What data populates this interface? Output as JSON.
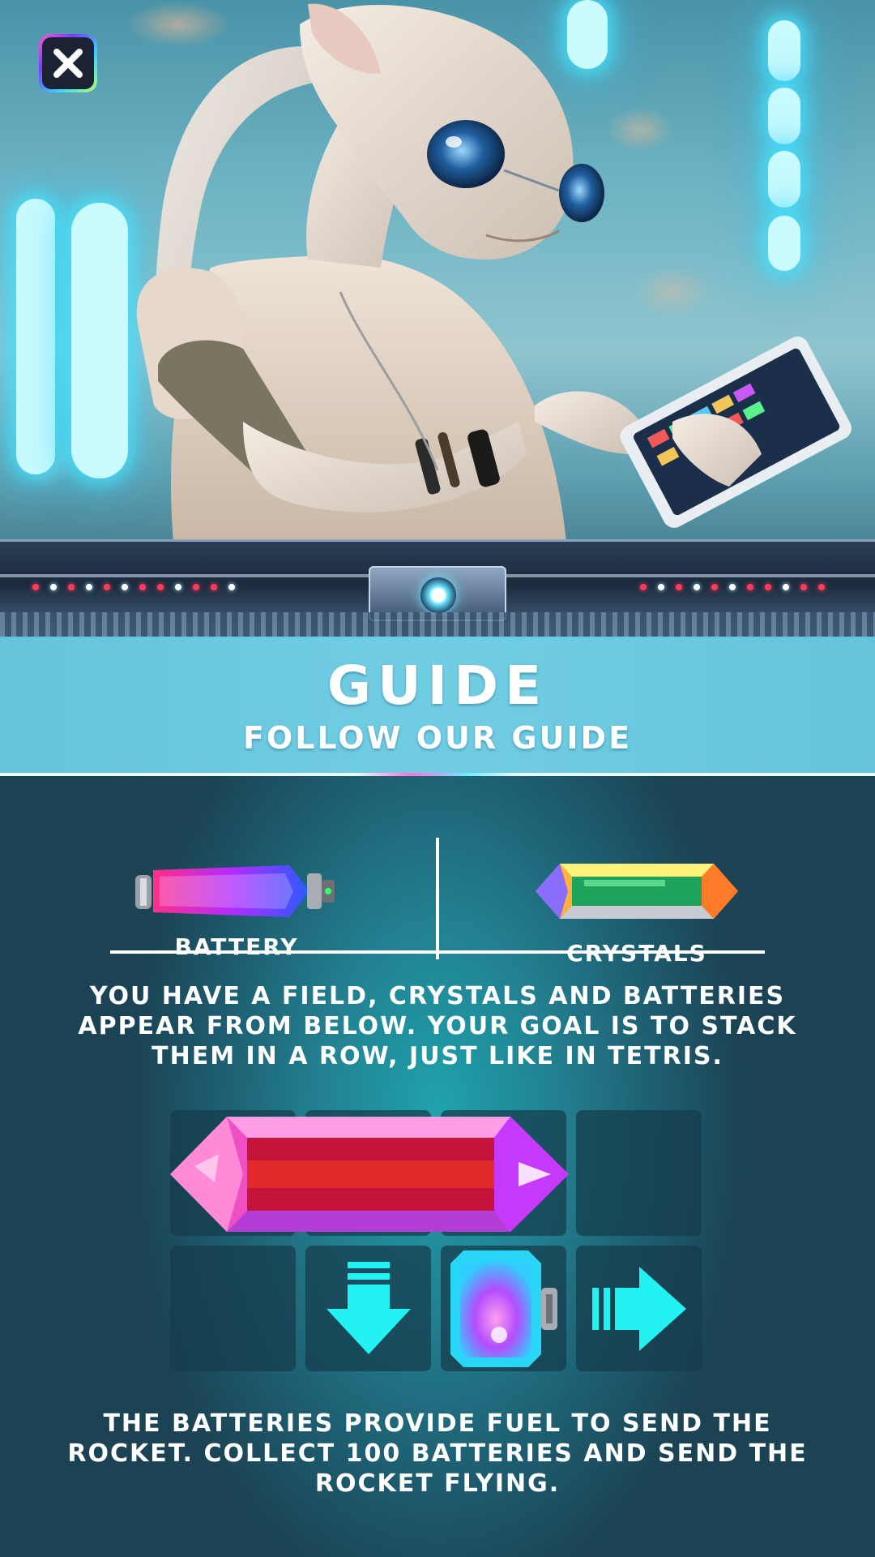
{
  "header": {
    "title": "GUIDE",
    "subtitle": "FOLLOW OUR GUIDE"
  },
  "close_button": {
    "icon": "close-icon",
    "label": "X"
  },
  "items": [
    {
      "label": "BATTERY",
      "icon": "battery-icon"
    },
    {
      "label": "CRYSTALS",
      "icon": "crystal-icon"
    }
  ],
  "instructions": {
    "paragraph_1": "YOU HAVE A FIELD, CRYSTALS AND BATTERIES APPEAR FROM BELOW. YOUR GOAL IS TO STACK THEM IN A ROW, JUST LIKE IN TETRIS.",
    "paragraph_2": "THE BATTERIES PROVIDE FUEL TO SEND THE ROCKET. COLLECT 100 BATTERIES AND SEND THE ROCKET FLYING."
  },
  "example_grid": {
    "rows": 2,
    "cols": 4,
    "pieces": [
      "pink-crystal-icon",
      "down-arrow-icon",
      "square-battery-icon",
      "right-arrow-icon"
    ]
  },
  "colors": {
    "header_bg": "#6ccadf",
    "body_bg": "#227f8f",
    "arrow": "#22f2f2",
    "text": "#ffffff"
  }
}
